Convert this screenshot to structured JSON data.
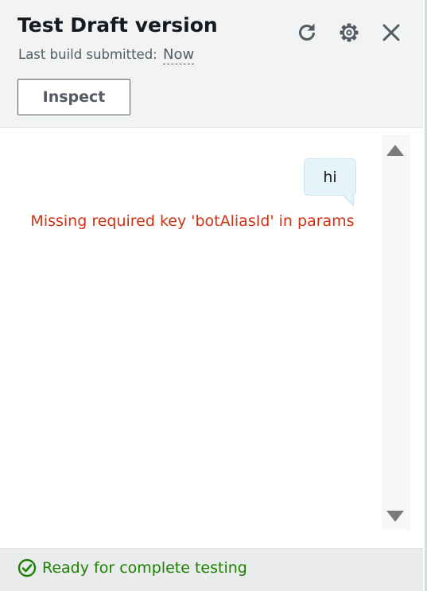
{
  "header": {
    "title": "Test Draft version",
    "subtitle_label": "Last build submitted:",
    "subtitle_time": "Now",
    "inspect_label": "Inspect",
    "icons": [
      "refresh-icon",
      "settings-icon",
      "close-icon"
    ]
  },
  "conversation": {
    "messages": [
      {
        "from": "user",
        "text": "hi"
      },
      {
        "from": "bot",
        "type": "error",
        "text": "Missing required key 'botAliasId' in params"
      }
    ]
  },
  "footer": {
    "status_text": "Ready for complete testing",
    "status_icon": "check-circle-icon"
  },
  "colors": {
    "header_bg": "#f2f3f3",
    "error": "#d13212",
    "success": "#1d8102",
    "user_bubble": "#e7f3fb",
    "footer_bg": "#e9ebed"
  }
}
